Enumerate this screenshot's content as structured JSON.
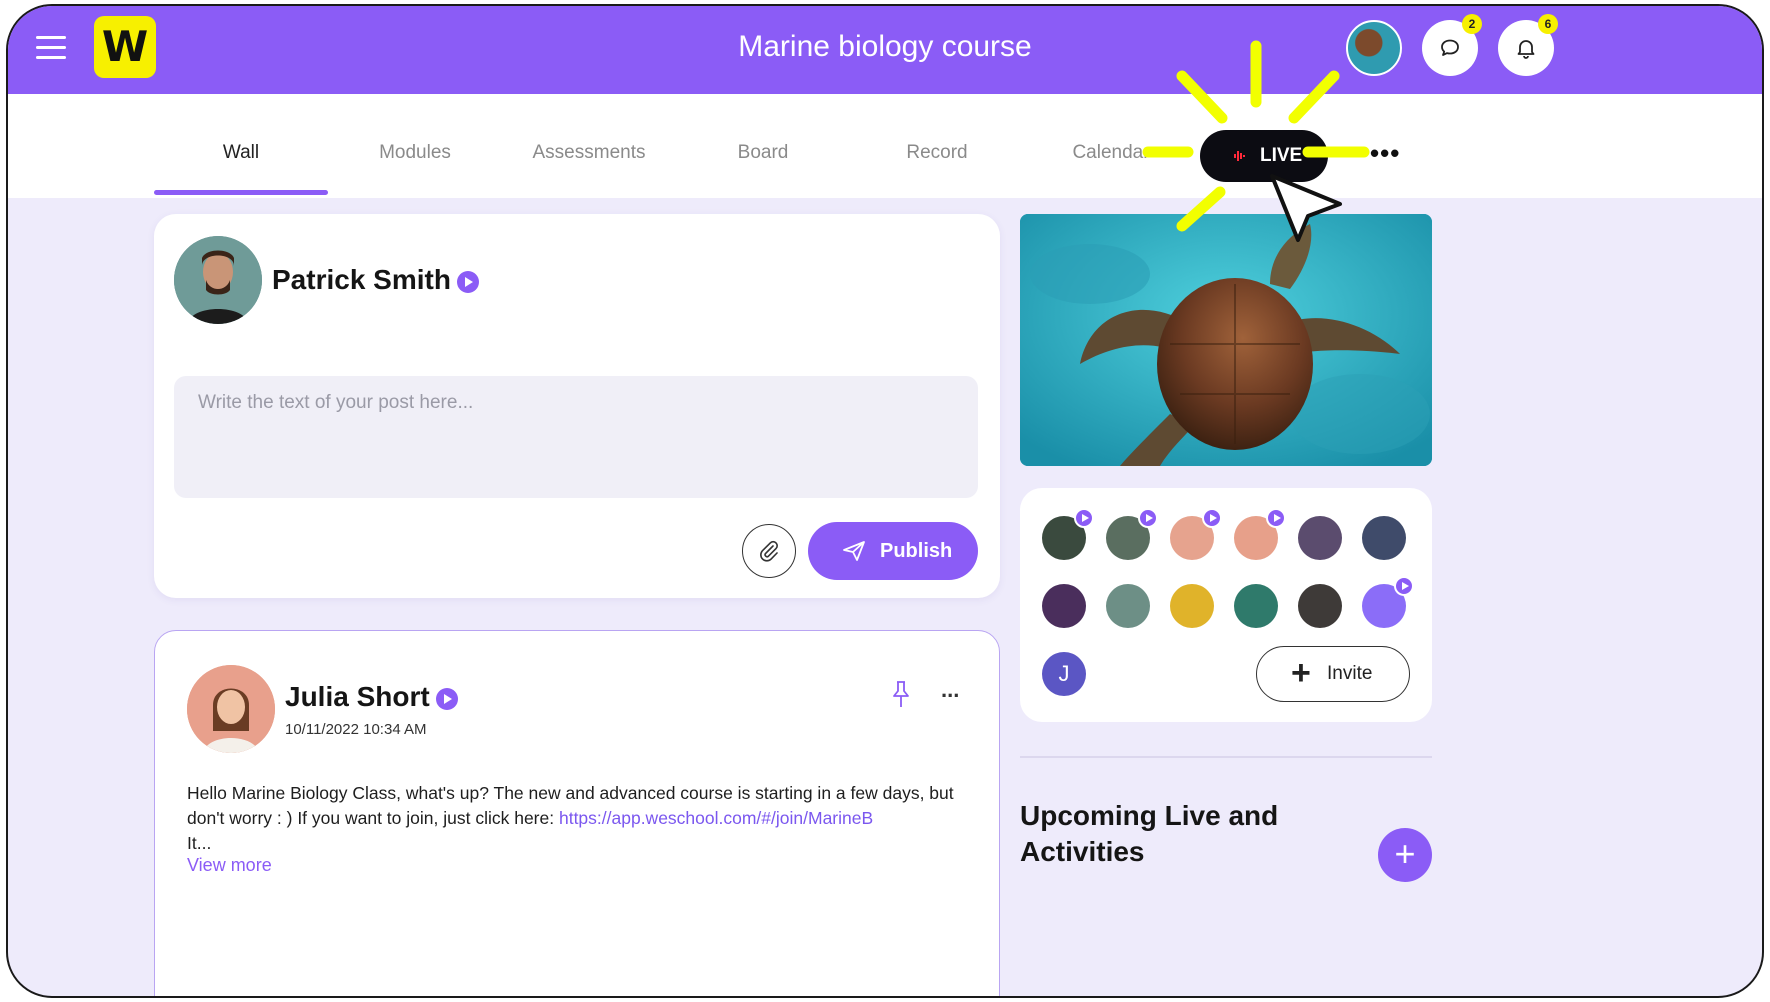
{
  "header": {
    "title": "Marine biology course",
    "logo_letter": "W",
    "chat_badge": "2",
    "notifications_badge": "6"
  },
  "tabs": [
    {
      "label": "Wall",
      "active": true
    },
    {
      "label": "Modules"
    },
    {
      "label": "Assessments"
    },
    {
      "label": "Board"
    },
    {
      "label": "Record"
    },
    {
      "label": "Calendar"
    }
  ],
  "live_button": {
    "label": "LIVE"
  },
  "more_tabs": "•••",
  "composer": {
    "user_name": "Patrick Smith",
    "placeholder": "Write the text of your post here...",
    "publish_label": "Publish"
  },
  "post": {
    "author": "Julia Short",
    "date": "10/11/2022 10:34 AM",
    "text_before_link": "Hello Marine Biology Class, what's up? The new and advanced course is starting in a few days, but don't worry : ) If you want to join, just click here: ",
    "link_text": "https://app.weschool.com/#/join/MarineB",
    "text_after_link": "It...",
    "view_more": "View more",
    "more": "..."
  },
  "participants": {
    "initial_avatar": "J",
    "invite_label": "Invite"
  },
  "upcoming": {
    "title": "Upcoming Live and Activities",
    "add_label": "+"
  },
  "colors": {
    "brand": "#8b5cf6",
    "logo": "#f7f000",
    "highlight": "#f2ff00",
    "background": "#eeebfb"
  }
}
